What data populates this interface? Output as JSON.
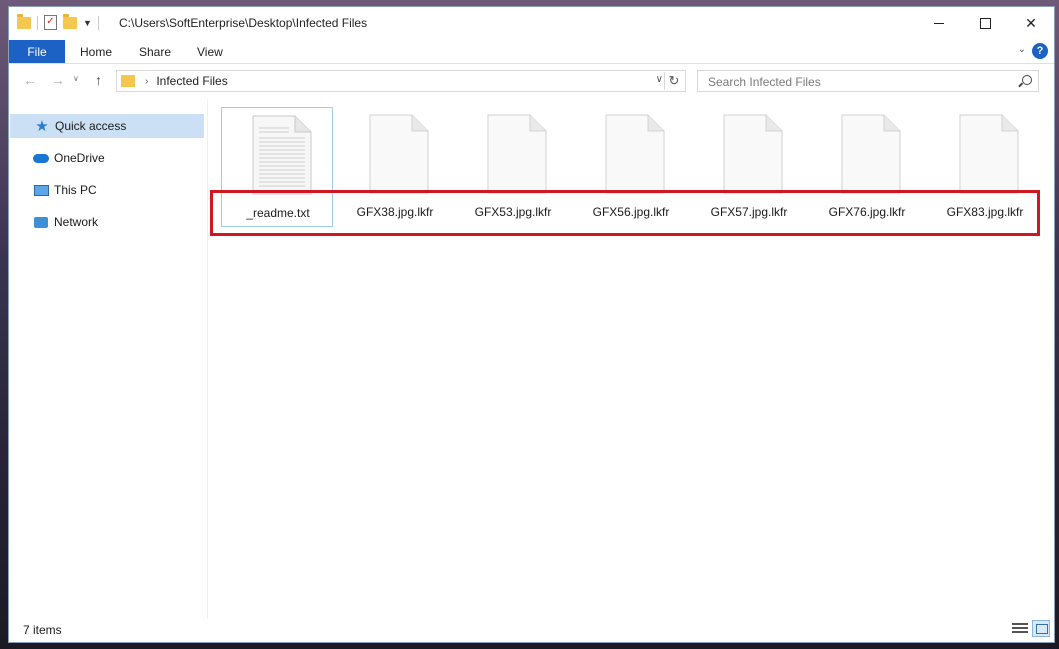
{
  "window": {
    "title_path": "C:\\Users\\SoftEnterprise\\Desktop\\Infected Files"
  },
  "ribbon": {
    "tabs": [
      {
        "label": "File",
        "active": true
      },
      {
        "label": "Home"
      },
      {
        "label": "Share"
      },
      {
        "label": "View"
      }
    ],
    "help_label": "?"
  },
  "address": {
    "current_folder": "Infected Files",
    "search_placeholder": "Search Infected Files"
  },
  "navpane": {
    "items": [
      {
        "label": "Quick access",
        "icon": "star-icon",
        "selected": true
      },
      {
        "label": "OneDrive",
        "icon": "cloud-icon"
      },
      {
        "label": "This PC",
        "icon": "computer-icon"
      },
      {
        "label": "Network",
        "icon": "network-icon"
      }
    ]
  },
  "files": [
    {
      "name": "_readme.txt",
      "type": "text"
    },
    {
      "name": "GFX38.jpg.lkfr",
      "type": "blank"
    },
    {
      "name": "GFX53.jpg.lkfr",
      "type": "blank"
    },
    {
      "name": "GFX56.jpg.lkfr",
      "type": "blank"
    },
    {
      "name": "GFX57.jpg.lkfr",
      "type": "blank"
    },
    {
      "name": "GFX76.jpg.lkfr",
      "type": "blank"
    },
    {
      "name": "GFX83.jpg.lkfr",
      "type": "blank"
    }
  ],
  "status": {
    "item_count": "7 items"
  },
  "colors": {
    "accent": "#1b62c4",
    "highlight_box": "#d0161f",
    "selection": "#cce0f5"
  }
}
